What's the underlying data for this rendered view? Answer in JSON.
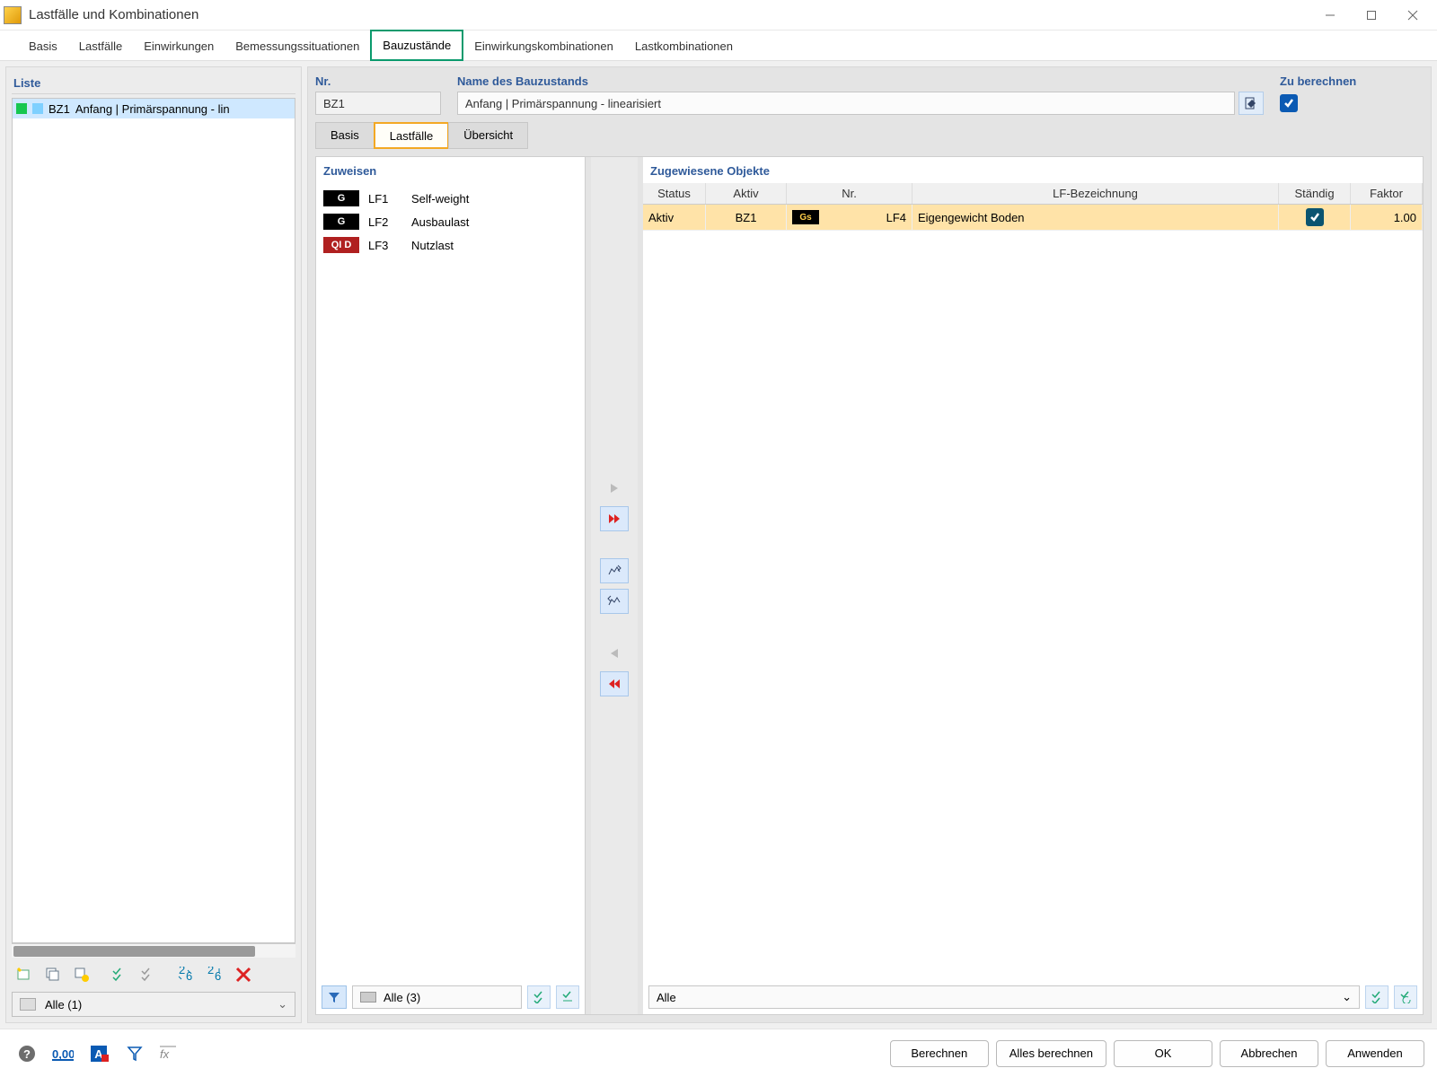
{
  "window": {
    "title": "Lastfälle und Kombinationen"
  },
  "toptabs": [
    "Basis",
    "Lastfälle",
    "Einwirkungen",
    "Bemessungssituationen",
    "Bauzustände",
    "Einwirkungskombinationen",
    "Lastkombinationen"
  ],
  "toptab_active": 4,
  "left": {
    "title": "Liste",
    "item_code": "BZ1",
    "item_label": "Anfang | Primärspannung - lin",
    "combo": "Alle (1)"
  },
  "header": {
    "nr_label": "Nr.",
    "nr_value": "BZ1",
    "name_label": "Name des Bauzustands",
    "name_value": "Anfang | Primärspannung - linearisiert",
    "calc_label": "Zu berechnen"
  },
  "subtabs": [
    "Basis",
    "Lastfälle",
    "Übersicht"
  ],
  "subtab_active": 1,
  "assign": {
    "title": "Zuweisen",
    "rows": [
      {
        "badge": "G",
        "cls": "g",
        "code": "LF1",
        "desc": "Self-weight"
      },
      {
        "badge": "G",
        "cls": "g",
        "code": "LF2",
        "desc": "Ausbaulast"
      },
      {
        "badge": "QI D",
        "cls": "q",
        "code": "LF3",
        "desc": "Nutzlast"
      }
    ]
  },
  "assigned": {
    "title": "Zugewiesene Objekte",
    "cols": {
      "status": "Status",
      "aktiv": "Aktiv",
      "nr": "Nr.",
      "bez": "LF-Bezeichnung",
      "stand": "Ständig",
      "fak": "Faktor"
    },
    "row": {
      "status": "Aktiv",
      "aktiv": "BZ1",
      "badge": "Gs",
      "nr": "LF4",
      "bez": "Eigengewicht Boden",
      "fak": "1.00"
    }
  },
  "filters": {
    "left": "Alle (3)",
    "right": "Alle"
  },
  "footer": {
    "berechnen": "Berechnen",
    "alles": "Alles berechnen",
    "ok": "OK",
    "abbrechen": "Abbrechen",
    "anwenden": "Anwenden"
  }
}
